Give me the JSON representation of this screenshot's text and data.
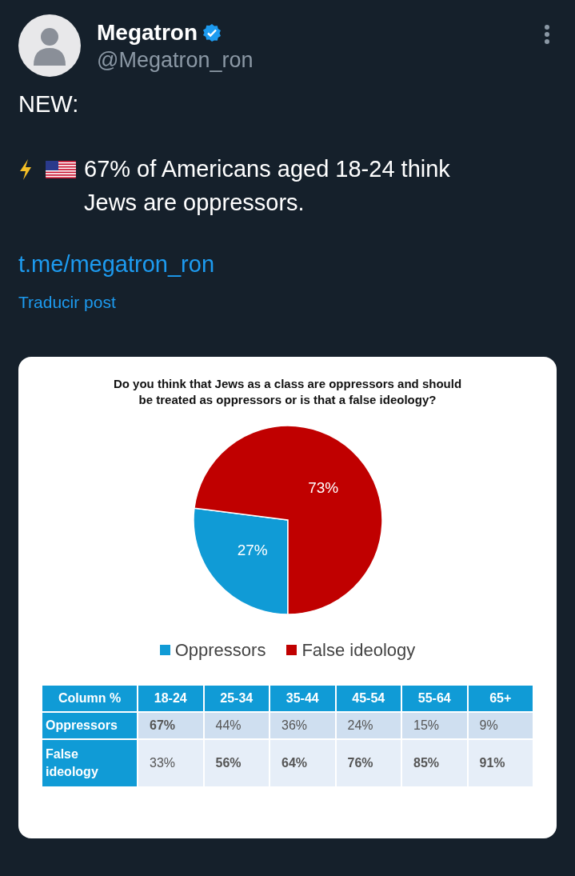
{
  "author": {
    "name": "Megatron",
    "verified": true,
    "handle": "@Megatron_ron"
  },
  "post": {
    "lead": "NEW:",
    "text": "67% of Americans aged 18-24 think Jews are oppressors.",
    "link": "t.me/megatron_ron",
    "translate": "Traducir post"
  },
  "image": {
    "question": "Do you think that Jews as a class are oppressors and should be treated as oppressors or is that a false ideology?",
    "chart_data": {
      "type": "pie",
      "categories": [
        "Oppressors",
        "False ideology"
      ],
      "values": [
        27,
        73
      ],
      "colors": [
        "#109bd6",
        "#c00000"
      ],
      "value_labels": [
        "27%",
        "73%"
      ]
    },
    "table": {
      "columns": [
        "Column %",
        "18-24",
        "25-34",
        "35-44",
        "45-54",
        "55-64",
        "65+"
      ],
      "rows": [
        {
          "cells": [
            {
              "text": "Oppressors",
              "bold": true
            },
            {
              "text": "67%",
              "bold": true
            },
            {
              "text": "44%",
              "bold": false
            },
            {
              "text": "36%",
              "bold": false
            },
            {
              "text": "24%",
              "bold": false
            },
            {
              "text": "15%",
              "bold": false
            },
            {
              "text": "9%",
              "bold": false
            }
          ]
        },
        {
          "cells": [
            {
              "text": "False ideology",
              "bold": true
            },
            {
              "text": "33%",
              "bold": false
            },
            {
              "text": "56%",
              "bold": true
            },
            {
              "text": "64%",
              "bold": true
            },
            {
              "text": "76%",
              "bold": true
            },
            {
              "text": "85%",
              "bold": true
            },
            {
              "text": "91%",
              "bold": true
            }
          ]
        }
      ]
    }
  }
}
